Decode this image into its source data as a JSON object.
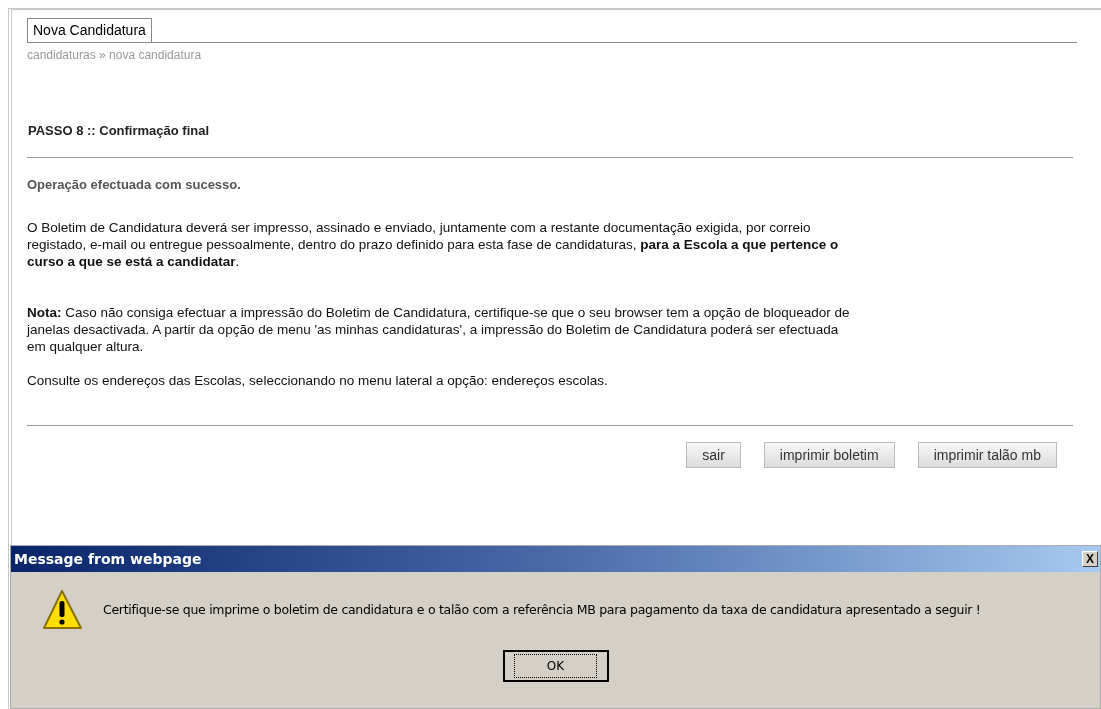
{
  "page_tab": "Nova Candidatura",
  "breadcrumb": "candidaturas » nova candidatura",
  "step_title": "PASSO 8 :: Confirmação final",
  "success_message": "Operação efectuada com sucesso.",
  "paragraphs": [
    "O Boletim de Candidatura deverá ser impresso, assinado e enviado, juntamente com a restante documentação exigida, por correio registado, e-mail ou entregue pessoalmente, dentro do prazo definido para esta fase de candidaturas, **para a Escola a que pertence o curso a que se está a candidatar**.",
    "**Nota:** Caso não consiga efectuar a impressão do Boletim de Candidatura, certifique-se que o seu browser tem a opção de bloqueador de janelas desactivada. A partir da opção de menu 'as minhas candidaturas', a impressão do Boletim de Candidatura poderá ser efectuada em qualquer altura.",
    "Consulte os endereços das Escolas, seleccionando no menu lateral a opção: endereços escolas."
  ],
  "buttons": [
    "sair",
    "imprimir boletim",
    "imprimir talão mb"
  ],
  "dialog": {
    "title": "Message from webpage",
    "close": "X",
    "message": "Certifique-se que imprime o boletim de candidatura e o talão com a referência MB para pagamento da taxa de candidatura apresentado a seguir !",
    "button": "OK"
  }
}
